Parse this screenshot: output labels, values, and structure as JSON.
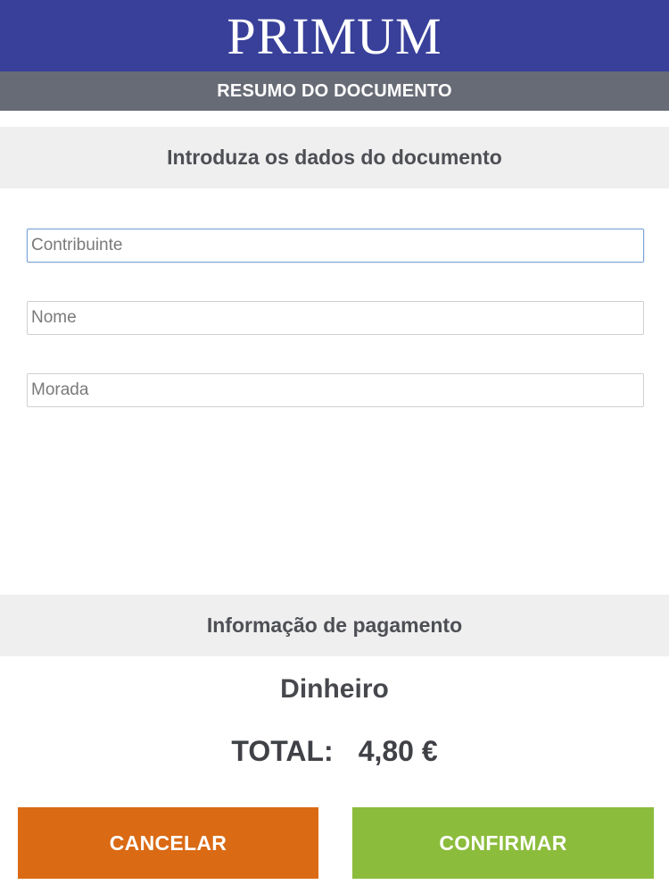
{
  "header": {
    "brand": "PRIMUM",
    "subtitle": "RESUMO DO DOCUMENTO"
  },
  "document_section": {
    "title": "Introduza os dados do documento",
    "fields": {
      "contribuinte": {
        "value": "",
        "placeholder": "Contribuinte"
      },
      "nome": {
        "value": "",
        "placeholder": "Nome"
      },
      "morada": {
        "value": "",
        "placeholder": "Morada"
      }
    }
  },
  "payment_section": {
    "title": "Informação de pagamento",
    "method": "Dinheiro",
    "total_label": "TOTAL:",
    "total_value": "4,80 €"
  },
  "actions": {
    "cancel_label": "CANCELAR",
    "confirm_label": "CONFIRMAR"
  },
  "colors": {
    "brand_bar": "#38409a",
    "subheader_bar": "#676b75",
    "section_bg": "#efefef",
    "cancel_button": "#da6a14",
    "confirm_button": "#8cbc3c"
  }
}
